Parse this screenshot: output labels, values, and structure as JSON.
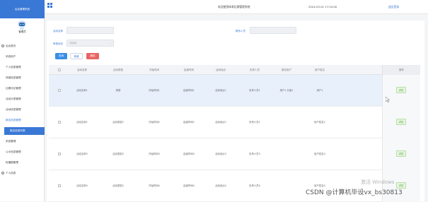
{
  "sidebar": {
    "brand": "后台管理系统",
    "user_name": "管理员",
    "items": [
      {
        "label": "后台首页",
        "type": "top"
      },
      {
        "label": "系统用户",
        "type": "normal"
      },
      {
        "label": "个人信息管理",
        "type": "normal"
      },
      {
        "label": "场馆信息管理",
        "type": "normal"
      },
      {
        "label": "比赛评论管理",
        "type": "normal"
      },
      {
        "label": "活动分类管理",
        "type": "normal"
      },
      {
        "label": "活动信息管理",
        "type": "normal"
      },
      {
        "label": "报名信息管理",
        "type": "parent"
      },
      {
        "label": "报名信息列表",
        "type": "active"
      },
      {
        "label": "系统管理",
        "type": "normal"
      },
      {
        "label": "公示信息管理",
        "type": "normal"
      },
      {
        "label": "轮播图管理",
        "type": "normal"
      },
      {
        "label": "个人信息",
        "type": "top"
      }
    ]
  },
  "header": {
    "title": "欢迎使用体育比赛管理系统",
    "time": "2024-03-01 17:24:00",
    "logout": "退出登录"
  },
  "filters": {
    "activity_name_label": "活动名称",
    "activity_name_placeholder": "",
    "contact_label": "联系人员",
    "contact_placeholder": "",
    "review_label": "审核状态",
    "review_value": "请选择"
  },
  "buttons": {
    "search": "查询",
    "add": "新增",
    "delete": "删除"
  },
  "table": {
    "columns": [
      "活动名称",
      "活动类型",
      "开始时间",
      "结束时间",
      "活动地点",
      "负责人员",
      "报名用户",
      "用户姓名"
    ],
    "op_header": "操作",
    "rows": [
      {
        "cells": [
          "活动名称1",
          "球赛",
          "开始时间1",
          "结束时间1",
          "活动地点1",
          "负责人员1",
          "用户1 分组1",
          "用户1"
        ],
        "op": "详情"
      },
      {
        "cells": [
          "活动名称2",
          "活动类型2",
          "开始时间2",
          "结束时间2",
          "活动地点2",
          "负责人员2",
          "",
          "用户姓名2"
        ],
        "op": "详情"
      },
      {
        "cells": [
          "活动名称3",
          "活动类型3",
          "开始时间3",
          "结束时间3",
          "活动地点3",
          "负责人员3",
          "",
          "用户姓名3"
        ],
        "op": "详情"
      },
      {
        "cells": [
          "活动名称4",
          "活动类型4",
          "开始时间4",
          "结束时间4",
          "活动地点4",
          "负责人员4",
          "",
          "用户姓名4"
        ],
        "op": "详情"
      }
    ]
  },
  "watermark": {
    "windows": "激活 Windows",
    "csdn": "CSDN @计算机毕设vx_bs30813"
  },
  "colors": {
    "accent": "#3a78d6",
    "danger": "#e96464",
    "success": "#5aa63e"
  }
}
